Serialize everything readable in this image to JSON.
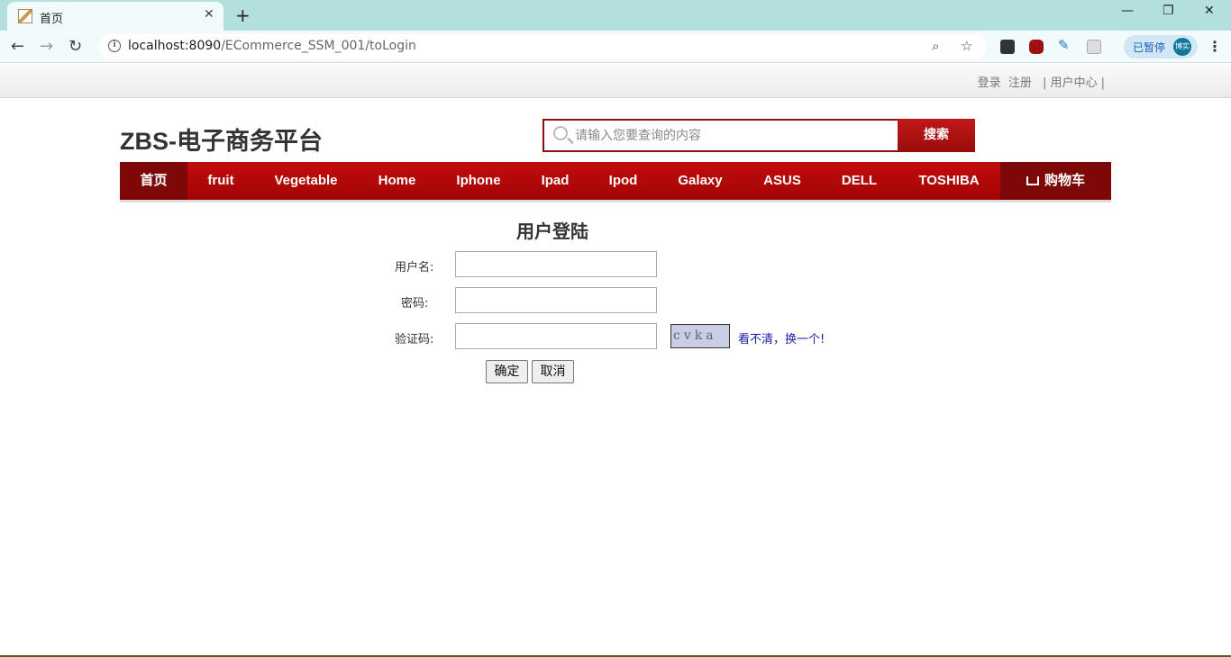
{
  "browser": {
    "tab_title": "首页",
    "url_host": "localhost:8090",
    "url_path": "/ECommerce_SSM_001/toLogin",
    "profile_status": "已暂停",
    "profile_avatar": "博实"
  },
  "topbar": {
    "login": "登录",
    "register": "注册",
    "user_center": "| 用户中心 |",
    "sep": "|"
  },
  "site": {
    "logo": "ZBS-电子商务平台",
    "search_placeholder": "请输入您要查询的内容",
    "search_button": "搜索"
  },
  "nav": {
    "items": [
      "首页",
      "fruit",
      "Vegetable",
      "Home",
      "Iphone",
      "Ipad",
      "Ipod",
      "Galaxy",
      "ASUS",
      "DELL",
      "TOSHIBA"
    ],
    "cart": "购物车"
  },
  "login": {
    "title": "用户登陆",
    "username_label": "用户名:",
    "password_label": "密码:",
    "captcha_label": "验证码:",
    "captcha_text": "cvka",
    "refresh_link": "看不清，换一个!",
    "confirm": "确定",
    "cancel": "取消"
  },
  "colors": {
    "nav_red": "#b00808",
    "nav_dark": "#7c0808",
    "tabbar": "#b4dfdf"
  }
}
